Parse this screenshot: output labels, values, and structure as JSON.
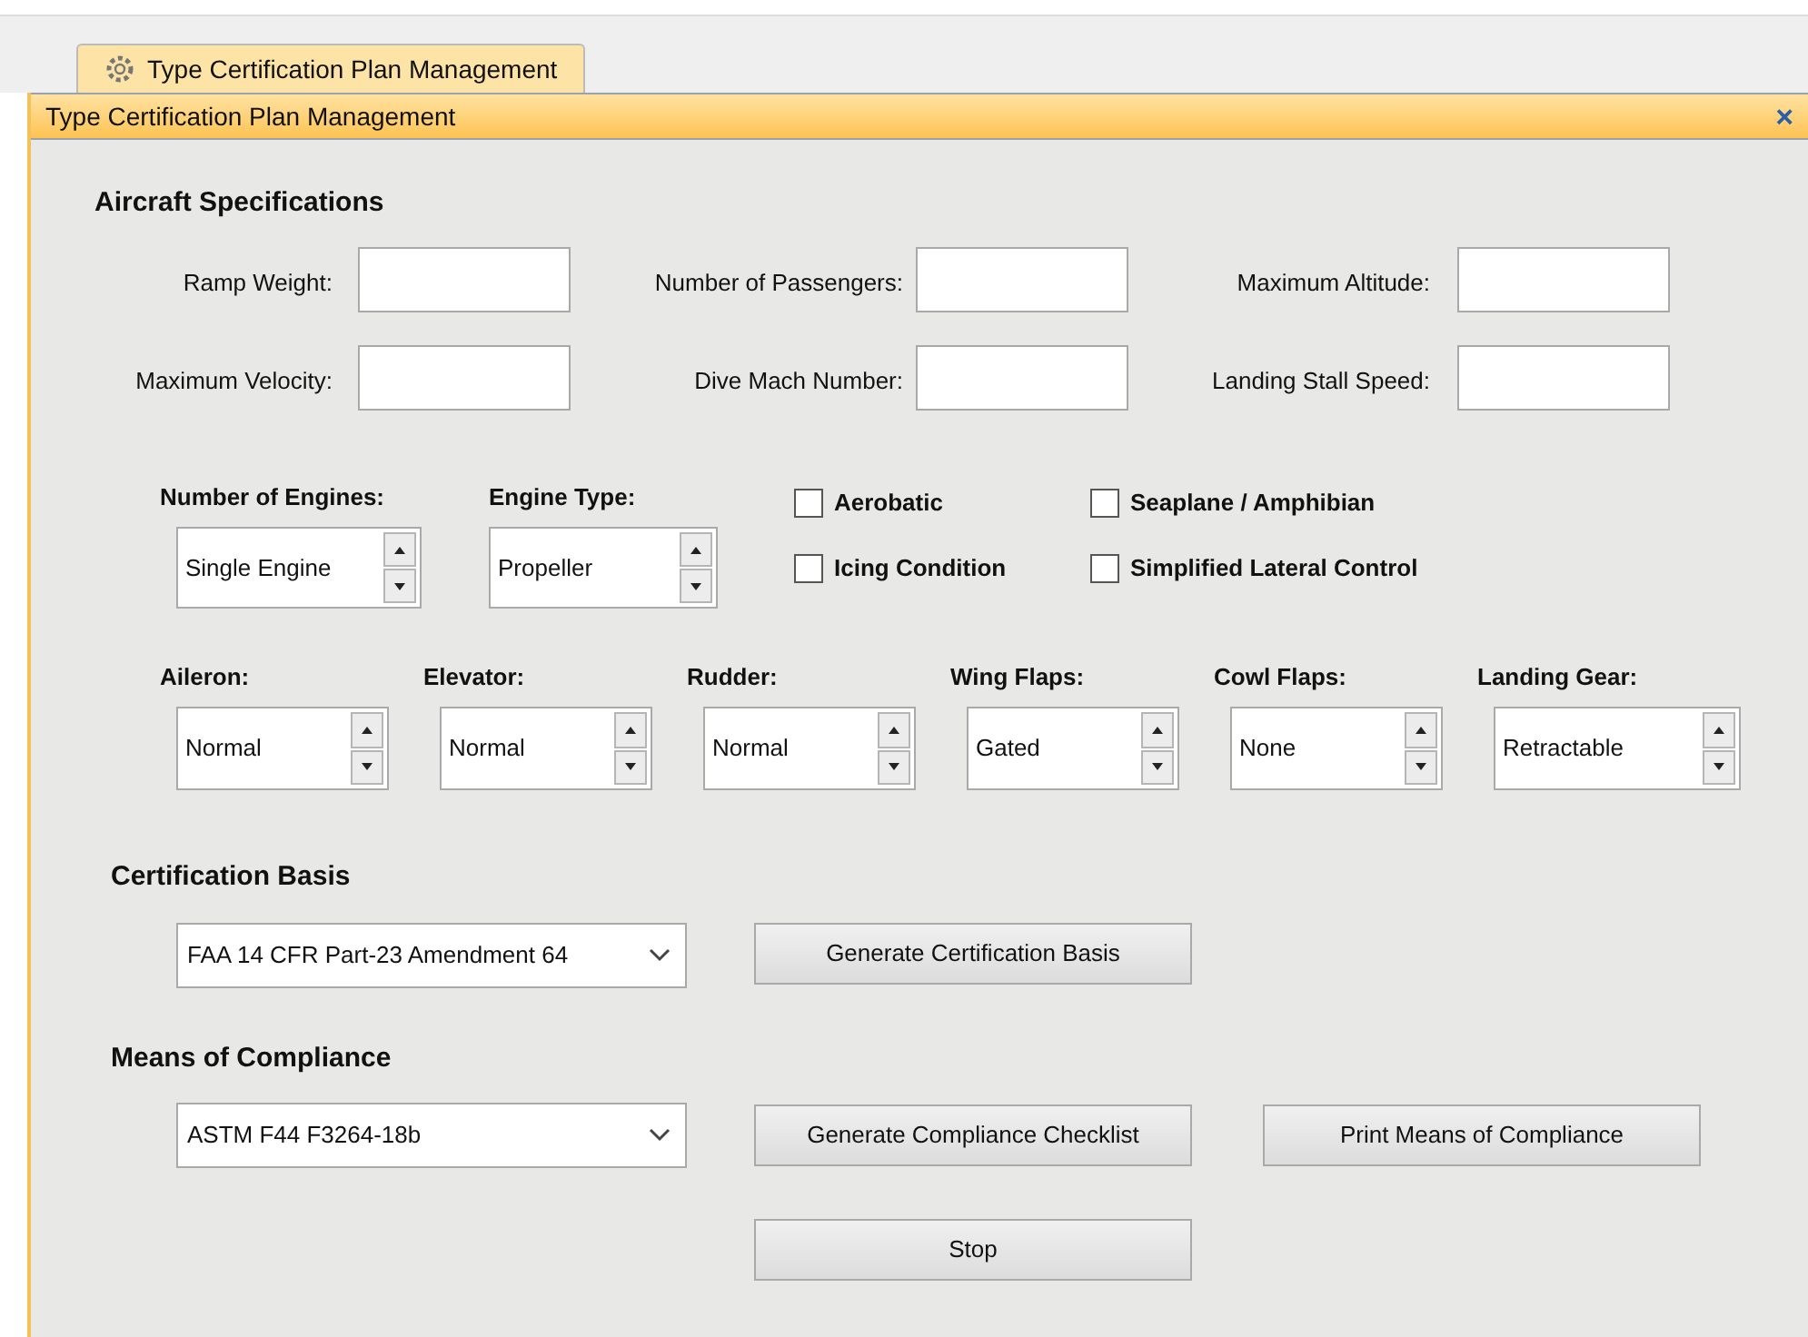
{
  "tab": {
    "label": "Type Certification Plan Management",
    "selected": true
  },
  "panel": {
    "title": "Type Certification Plan Management",
    "close": "×"
  },
  "aircraft_specifications": {
    "heading": "Aircraft Specifications",
    "fields": [
      {
        "label": "Ramp Weight:"
      },
      {
        "label": "Number of Passengers:"
      },
      {
        "label": "Maximum Altitude:"
      },
      {
        "label": "Maximum Velocity:"
      },
      {
        "label": "Dive Mach Number:"
      },
      {
        "label": "Landing Stall Speed:"
      }
    ]
  },
  "engine": {
    "spinners": [
      {
        "label": "Number of Engines:",
        "value": "Single Engine"
      },
      {
        "label": "Engine Type:",
        "value": "Propeller"
      }
    ],
    "checkboxes": [
      {
        "label": "Aerobatic",
        "checked": false
      },
      {
        "label": "Seaplane / Amphibian",
        "checked": false
      },
      {
        "label": "Icing Condition",
        "checked": false
      },
      {
        "label": "Simplified Lateral Control",
        "checked": false
      }
    ]
  },
  "controls": [
    {
      "label": "Aileron:",
      "value": "Normal"
    },
    {
      "label": "Elevator:",
      "value": "Normal"
    },
    {
      "label": "Rudder:",
      "value": "Normal"
    },
    {
      "label": "Wing Flaps:",
      "value": "Gated"
    },
    {
      "label": "Cowl Flaps:",
      "value": "None"
    },
    {
      "label": "Landing Gear:",
      "value": "Retractable"
    }
  ],
  "certification_basis": {
    "heading": "Certification Basis",
    "dropdown": {
      "value": "FAA 14 CFR Part-23 Amendment 64"
    },
    "buttons": [
      "Generate Certification Basis"
    ]
  },
  "means_of_compliance": {
    "heading": "Means of Compliance",
    "dropdown": {
      "value": "ASTM F44 F3264-18b"
    },
    "buttons": [
      "Generate Compliance Checklist",
      "Print Means of Compliance"
    ]
  },
  "stop_button": "Stop"
}
